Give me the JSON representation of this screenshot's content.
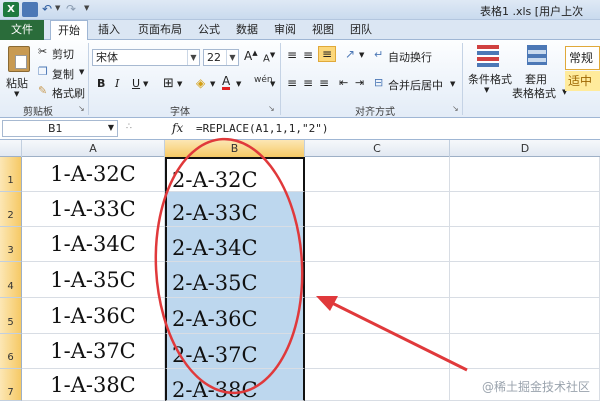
{
  "title_bar": {
    "title": "表格1 .xls [用户上次"
  },
  "tabs": [
    {
      "label": "文件"
    },
    {
      "label": "开始"
    },
    {
      "label": "插入"
    },
    {
      "label": "页面布局"
    },
    {
      "label": "公式"
    },
    {
      "label": "数据"
    },
    {
      "label": "审阅"
    },
    {
      "label": "视图"
    },
    {
      "label": "团队"
    }
  ],
  "ribbon": {
    "clipboard": {
      "paste": "粘贴",
      "cut": "剪切",
      "copy": "复制",
      "format_painter": "格式刷",
      "group_label": "剪贴板"
    },
    "font": {
      "font_name": "宋体",
      "font_size": "22",
      "bold": "B",
      "italic": "I",
      "underline": "U",
      "group_label": "字体",
      "phonetic": "wén"
    },
    "alignment": {
      "wrap_text": "自动换行",
      "merge_center": "合并后居中",
      "group_label": "对齐方式"
    },
    "styles": {
      "conditional_format": "条件格式",
      "table_format_1": "套用",
      "table_format_2": "表格格式",
      "number_format": "常规",
      "cell_style": "适中"
    }
  },
  "formula_bar": {
    "name_box": "B1",
    "fx": "fx",
    "formula": "=REPLACE(A1,1,1,\"2\")"
  },
  "columns": [
    "A",
    "B",
    "C",
    "D"
  ],
  "rows": [
    {
      "num": "1",
      "a": "1-A-32C",
      "b": "2-A-32C"
    },
    {
      "num": "2",
      "a": "1-A-33C",
      "b": "2-A-33C"
    },
    {
      "num": "3",
      "a": "1-A-34C",
      "b": "2-A-34C"
    },
    {
      "num": "4",
      "a": "1-A-35C",
      "b": "2-A-35C"
    },
    {
      "num": "5",
      "a": "1-A-36C",
      "b": "2-A-36C"
    },
    {
      "num": "6",
      "a": "1-A-37C",
      "b": "2-A-37C"
    },
    {
      "num": "7",
      "a": "1-A-38C",
      "b": "2-A-38C"
    }
  ],
  "watermark": "@稀土掘金技术社区",
  "colors": {
    "file_tab": "#2a6c3a",
    "selection": "#bdd7ee",
    "annotation": "#e0393b"
  }
}
